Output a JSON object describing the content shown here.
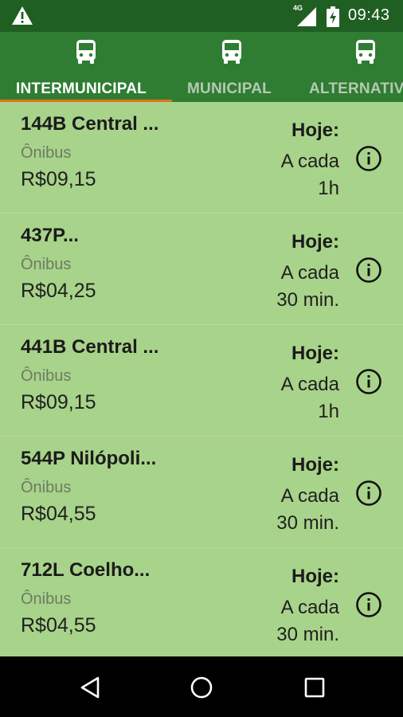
{
  "status_bar": {
    "time": "09:43",
    "network": "4G",
    "icons": [
      "warning-icon",
      "signal-icon",
      "battery-charging-icon"
    ]
  },
  "tabs": [
    {
      "label": "INTERMUNICIPAL",
      "icon": "bus-icon",
      "active": true
    },
    {
      "label": "MUNICIPAL",
      "icon": "bus-icon",
      "active": false
    },
    {
      "label": "ALTERNATIVO",
      "icon": "bus-icon",
      "active": false
    }
  ],
  "routes": [
    {
      "name": "144B Central ...",
      "mode": "Ônibus",
      "price": "R$09,15",
      "today_label": "Hoje:",
      "freq_line1": "A cada",
      "freq_line2": "1h"
    },
    {
      "name": "437P...",
      "mode": "Ônibus",
      "price": "R$04,25",
      "today_label": "Hoje:",
      "freq_line1": "A cada",
      "freq_line2": "30 min."
    },
    {
      "name": "441B Central ...",
      "mode": "Ônibus",
      "price": "R$09,15",
      "today_label": "Hoje:",
      "freq_line1": "A cada",
      "freq_line2": "1h"
    },
    {
      "name": "544P Nilópoli...",
      "mode": "Ônibus",
      "price": "R$04,55",
      "today_label": "Hoje:",
      "freq_line1": "A cada",
      "freq_line2": "30 min."
    },
    {
      "name": "712L Coelho...",
      "mode": "Ônibus",
      "price": "R$04,55",
      "today_label": "Hoje:",
      "freq_line1": "A cada",
      "freq_line2": "30 min."
    }
  ],
  "colors": {
    "status_bar": "#1f5f22",
    "tab_bar": "#2e7d32",
    "tab_indicator": "#e4711a",
    "list_background": "#a8d38a",
    "nav_bar": "#000000"
  },
  "nav_bar": {
    "buttons": [
      "back-icon",
      "home-icon",
      "recents-icon"
    ]
  }
}
